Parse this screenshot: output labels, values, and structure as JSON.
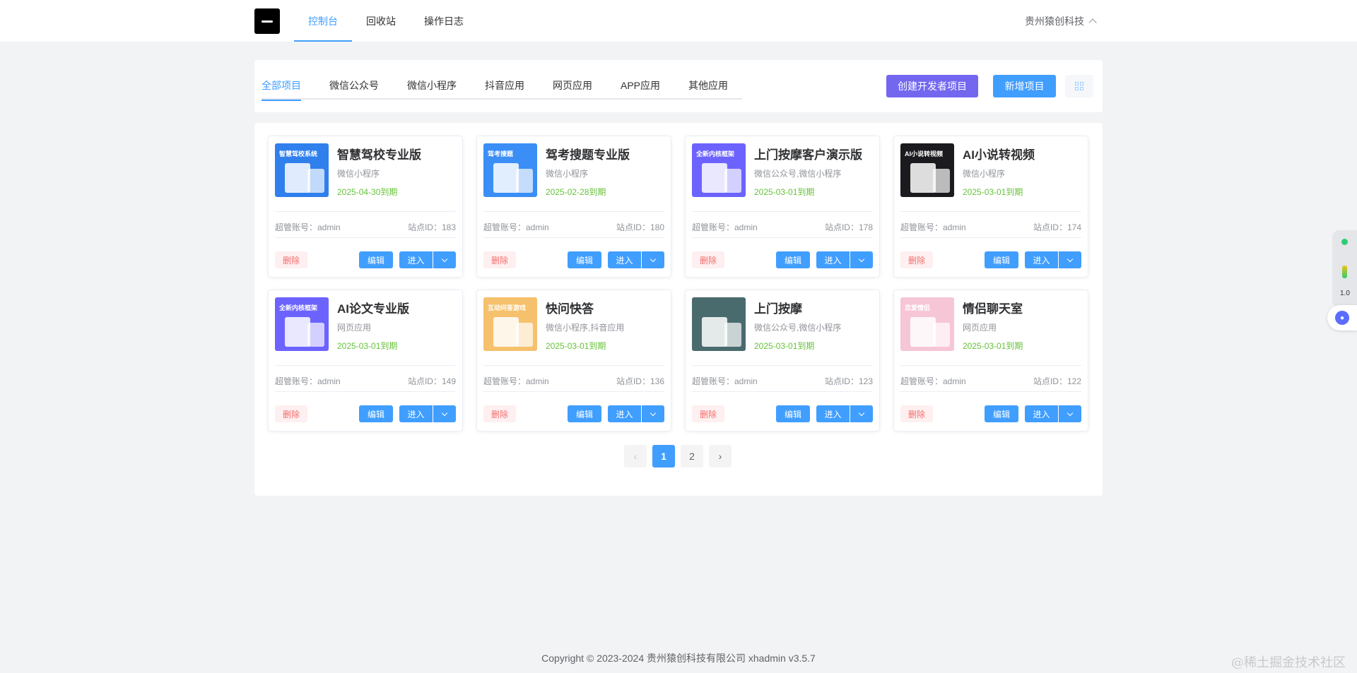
{
  "header": {
    "nav": [
      {
        "label": "控制台",
        "active": true
      },
      {
        "label": "回收站",
        "active": false
      },
      {
        "label": "操作日志",
        "active": false
      }
    ],
    "company": "贵州猿创科技"
  },
  "filter": {
    "tabs": [
      {
        "label": "全部项目",
        "active": true
      },
      {
        "label": "微信公众号",
        "active": false
      },
      {
        "label": "微信小程序",
        "active": false
      },
      {
        "label": "抖音应用",
        "active": false
      },
      {
        "label": "网页应用",
        "active": false
      },
      {
        "label": "APP应用",
        "active": false
      },
      {
        "label": "其他应用",
        "active": false
      }
    ],
    "create_dev_label": "创建开发者项目",
    "new_project_label": "新增项目"
  },
  "cards": [
    {
      "title": "智慧驾校专业版",
      "type": "微信小程序",
      "expire": "2025-04-30到期",
      "account": "超管账号：admin",
      "siteid": "站点ID：183",
      "thumb_text": "智慧驾校系统",
      "thumb_color": "#2f80ed"
    },
    {
      "title": "驾考搜题专业版",
      "type": "微信小程序",
      "expire": "2025-02-28到期",
      "account": "超管账号：admin",
      "siteid": "站点ID：180",
      "thumb_text": "驾考搜题",
      "thumb_color": "#3a8ef6"
    },
    {
      "title": "上门按摩客户演示版",
      "type": "微信公众号,微信小程序",
      "expire": "2025-03-01到期",
      "account": "超管账号：admin",
      "siteid": "站点ID：178",
      "thumb_text": "全新内核框架",
      "thumb_color": "#6c63ff"
    },
    {
      "title": "AI小说转视频",
      "type": "微信小程序",
      "expire": "2025-03-01到期",
      "account": "超管账号：admin",
      "siteid": "站点ID：174",
      "thumb_text": "AI小说转视频",
      "thumb_color": "#1b1b1f"
    },
    {
      "title": "AI论文专业版",
      "type": "网页应用",
      "expire": "2025-03-01到期",
      "account": "超管账号：admin",
      "siteid": "站点ID：149",
      "thumb_text": "全新内核框架",
      "thumb_color": "#6c63ff"
    },
    {
      "title": "快问快答",
      "type": "微信小程序,抖音应用",
      "expire": "2025-03-01到期",
      "account": "超管账号：admin",
      "siteid": "站点ID：136",
      "thumb_text": "互动问答游戏",
      "thumb_color": "#f5c16c"
    },
    {
      "title": "上门按摩",
      "type": "微信公众号,微信小程序",
      "expire": "2025-03-01到期",
      "account": "超管账号：admin",
      "siteid": "站点ID：123",
      "thumb_text": "",
      "thumb_color": "#4a6b6e"
    },
    {
      "title": "情侣聊天室",
      "type": "网页应用",
      "expire": "2025-03-01到期",
      "account": "超管账号：admin",
      "siteid": "站点ID：122",
      "thumb_text": "恋爱情侣",
      "thumb_color": "#f7c6d6"
    }
  ],
  "card_buttons": {
    "delete": "删除",
    "edit": "编辑",
    "enter": "进入"
  },
  "pagination": {
    "pages": [
      "1",
      "2"
    ],
    "current": 1
  },
  "footer": "Copyright © 2023-2024 贵州猿创科技有限公司   xhadmin v3.5.7",
  "watermark": "@稀土掘金技术社区",
  "float_widget": {
    "value": "1.0"
  }
}
